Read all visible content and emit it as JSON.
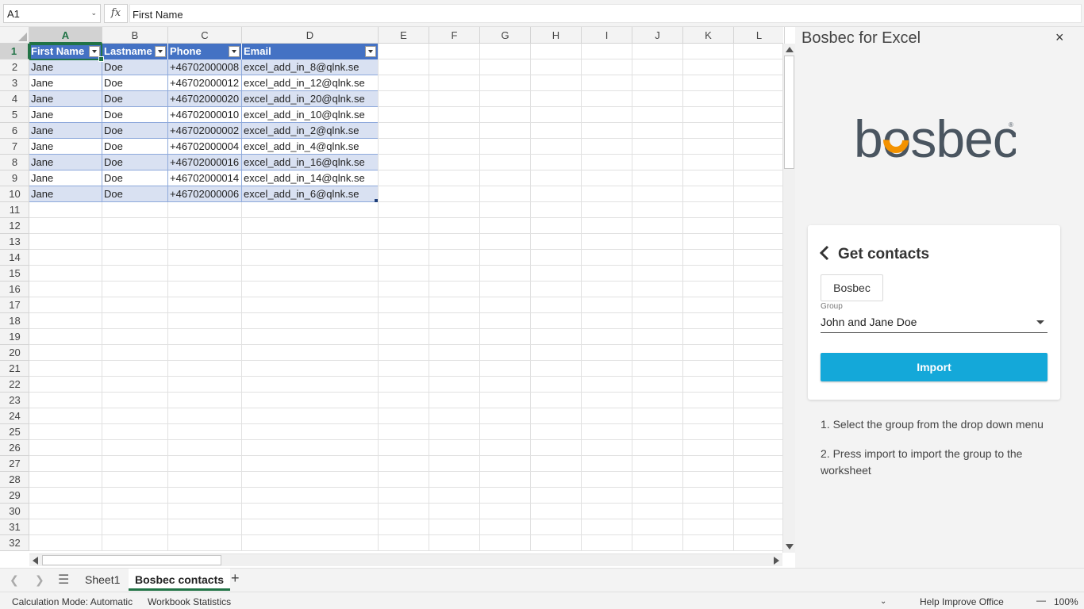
{
  "formula_bar": {
    "name_box": "A1",
    "fx": "fx",
    "content": "First Name"
  },
  "columns": [
    "A",
    "B",
    "C",
    "D",
    "E",
    "F",
    "G",
    "H",
    "I",
    "J",
    "K",
    "L"
  ],
  "rows": [
    "1",
    "2",
    "3",
    "4",
    "5",
    "6",
    "7",
    "8",
    "9",
    "10",
    "11",
    "12",
    "13",
    "14",
    "15",
    "16",
    "17",
    "18",
    "19",
    "20",
    "21",
    "22",
    "23",
    "24",
    "25",
    "26",
    "27",
    "28",
    "29",
    "30",
    "31",
    "32"
  ],
  "table": {
    "headers": [
      "First Name",
      "Lastname",
      "Phone",
      "Email"
    ],
    "rows": [
      [
        "Jane",
        "Doe",
        "+46702000008",
        "excel_add_in_8@qlnk.se"
      ],
      [
        "Jane",
        "Doe",
        "+46702000012",
        "excel_add_in_12@qlnk.se"
      ],
      [
        "Jane",
        "Doe",
        "+46702000020",
        "excel_add_in_20@qlnk.se"
      ],
      [
        "Jane",
        "Doe",
        "+46702000010",
        "excel_add_in_10@qlnk.se"
      ],
      [
        "Jane",
        "Doe",
        "+46702000002",
        "excel_add_in_2@qlnk.se"
      ],
      [
        "Jane",
        "Doe",
        "+46702000004",
        "excel_add_in_4@qlnk.se"
      ],
      [
        "Jane",
        "Doe",
        "+46702000016",
        "excel_add_in_16@qlnk.se"
      ],
      [
        "Jane",
        "Doe",
        "+46702000014",
        "excel_add_in_14@qlnk.se"
      ],
      [
        "Jane",
        "Doe",
        "+46702000006",
        "excel_add_in_6@qlnk.se"
      ]
    ]
  },
  "sheets": {
    "tabs": [
      "Sheet1",
      "Bosbec contacts"
    ],
    "active": "Bosbec contacts",
    "all_sheets_icon": "hamburger-icon",
    "add_icon": "+"
  },
  "status_bar": {
    "calc_mode": "Calculation Mode: Automatic",
    "workbook_stats": "Workbook Statistics",
    "help": "Help Improve Office",
    "zoom": "100%",
    "zoom_minus": "—"
  },
  "task_pane": {
    "title": "Bosbec for Excel",
    "close": "×",
    "logo_text": "bosbec",
    "logo_mark": "®",
    "card": {
      "title": "Get contacts",
      "source_button": "Bosbec",
      "group_label": "Group",
      "group_value": "John and Jane Doe",
      "import_label": "Import"
    },
    "instructions": [
      "1. Select the group from the drop down menu",
      "2. Press import to import the group to the worksheet"
    ]
  },
  "colors": {
    "excel_green": "#217346",
    "table_header": "#4472c4",
    "table_band": "#d9e1f2",
    "import_blue": "#14a8d9",
    "logo_gray": "#4a5560",
    "logo_orange": "#f39200",
    "logo_blue": "#14a8d9"
  }
}
